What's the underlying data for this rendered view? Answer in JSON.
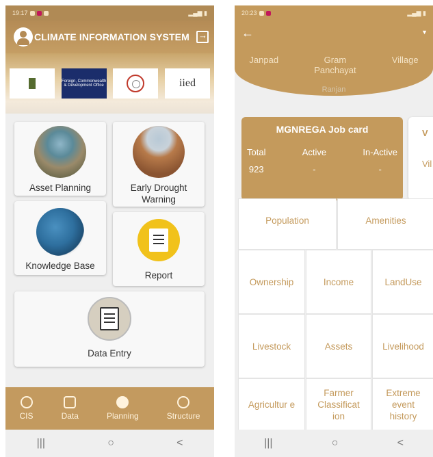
{
  "left": {
    "status": {
      "time": "19:17"
    },
    "appbar": {
      "title": "CLIMATE INFORMATION SYSTEM"
    },
    "logos": [
      {
        "name": "govt-logo",
        "text": ""
      },
      {
        "name": "fcdo-logo",
        "text": "Foreign, Commonwealth & Development Office"
      },
      {
        "name": "seal-logo",
        "text": ""
      },
      {
        "name": "iied-logo",
        "text": "iied"
      }
    ],
    "tiles": {
      "asset_planning": "Asset Planning",
      "early_drought": "Early Drought Warning",
      "knowledge_base": "Knowledge Base",
      "report": "Report",
      "data_entry": "Data Entry"
    },
    "nav": [
      "CIS",
      "Data",
      "Planning",
      "Structure"
    ],
    "sysbar": [
      "|||",
      "○",
      "<"
    ]
  },
  "right": {
    "status": {
      "time": "20:23"
    },
    "crumbs": [
      "Janpad",
      "Gram Panchayat",
      "Village"
    ],
    "crumb_sub": "Ranjan",
    "job_card": {
      "title": "MGNREGA Job card",
      "cols": [
        {
          "label": "Total",
          "value": "923"
        },
        {
          "label": "Active",
          "value": "-"
        },
        {
          "label": "In-Active",
          "value": "-"
        }
      ]
    },
    "village_card": {
      "title": "V",
      "sub": "Vil"
    },
    "cells": {
      "population": "Population",
      "amenities": "Amenities",
      "ownership": "Ownership",
      "income": "Income",
      "landuse": "LandUse",
      "livestock": "Livestock",
      "assets": "Assets",
      "livelihood": "Livelihood",
      "agriculture": "Agricultur e",
      "farmer": "Farmer Classificat ion",
      "extreme": "Extreme event history"
    },
    "sysbar": [
      "|||",
      "○",
      "<"
    ]
  },
  "colors": {
    "brand": "#c49a5c",
    "brand_dark": "#b08a55",
    "report_yellow": "#f1c21b",
    "fcdo_blue": "#1b2d6b"
  }
}
